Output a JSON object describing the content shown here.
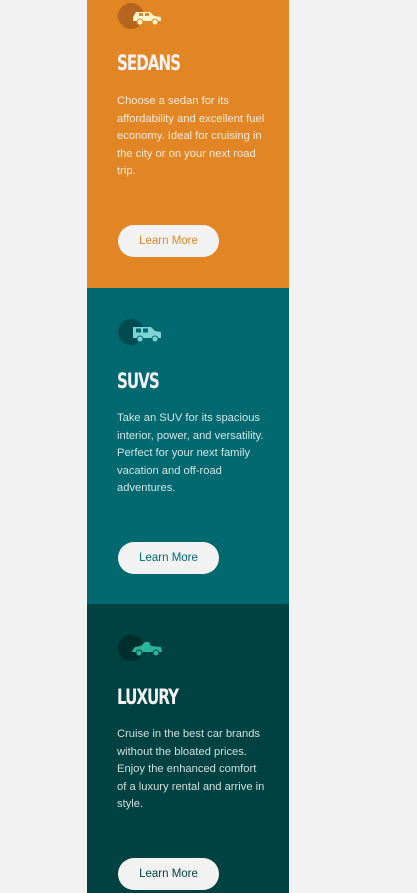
{
  "colors": {
    "page_background": "#f2f2f2",
    "sedans": "#e28625",
    "suvs": "#006970",
    "luxury": "#004241",
    "text_light": "#f2f2f2"
  },
  "cards": [
    {
      "icon": "sedan-car-icon",
      "title": "SEDANS",
      "text": "Choose a sedan for its affordability and excellent fuel economy. Ideal for cruising in the city or on your next road trip.",
      "button_label": "Learn More"
    },
    {
      "icon": "suv-car-icon",
      "title": "SUVS",
      "text": "Take an SUV for its spacious interior, power, and versatility. Perfect for your next family vacation and off-road adventures.",
      "button_label": "Learn More"
    },
    {
      "icon": "luxury-car-icon",
      "title": "LUXURY",
      "text": "Cruise in the best car brands without the bloated prices. Enjoy the enhanced comfort of a luxury rental and arrive in style.",
      "button_label": "Learn More"
    }
  ]
}
